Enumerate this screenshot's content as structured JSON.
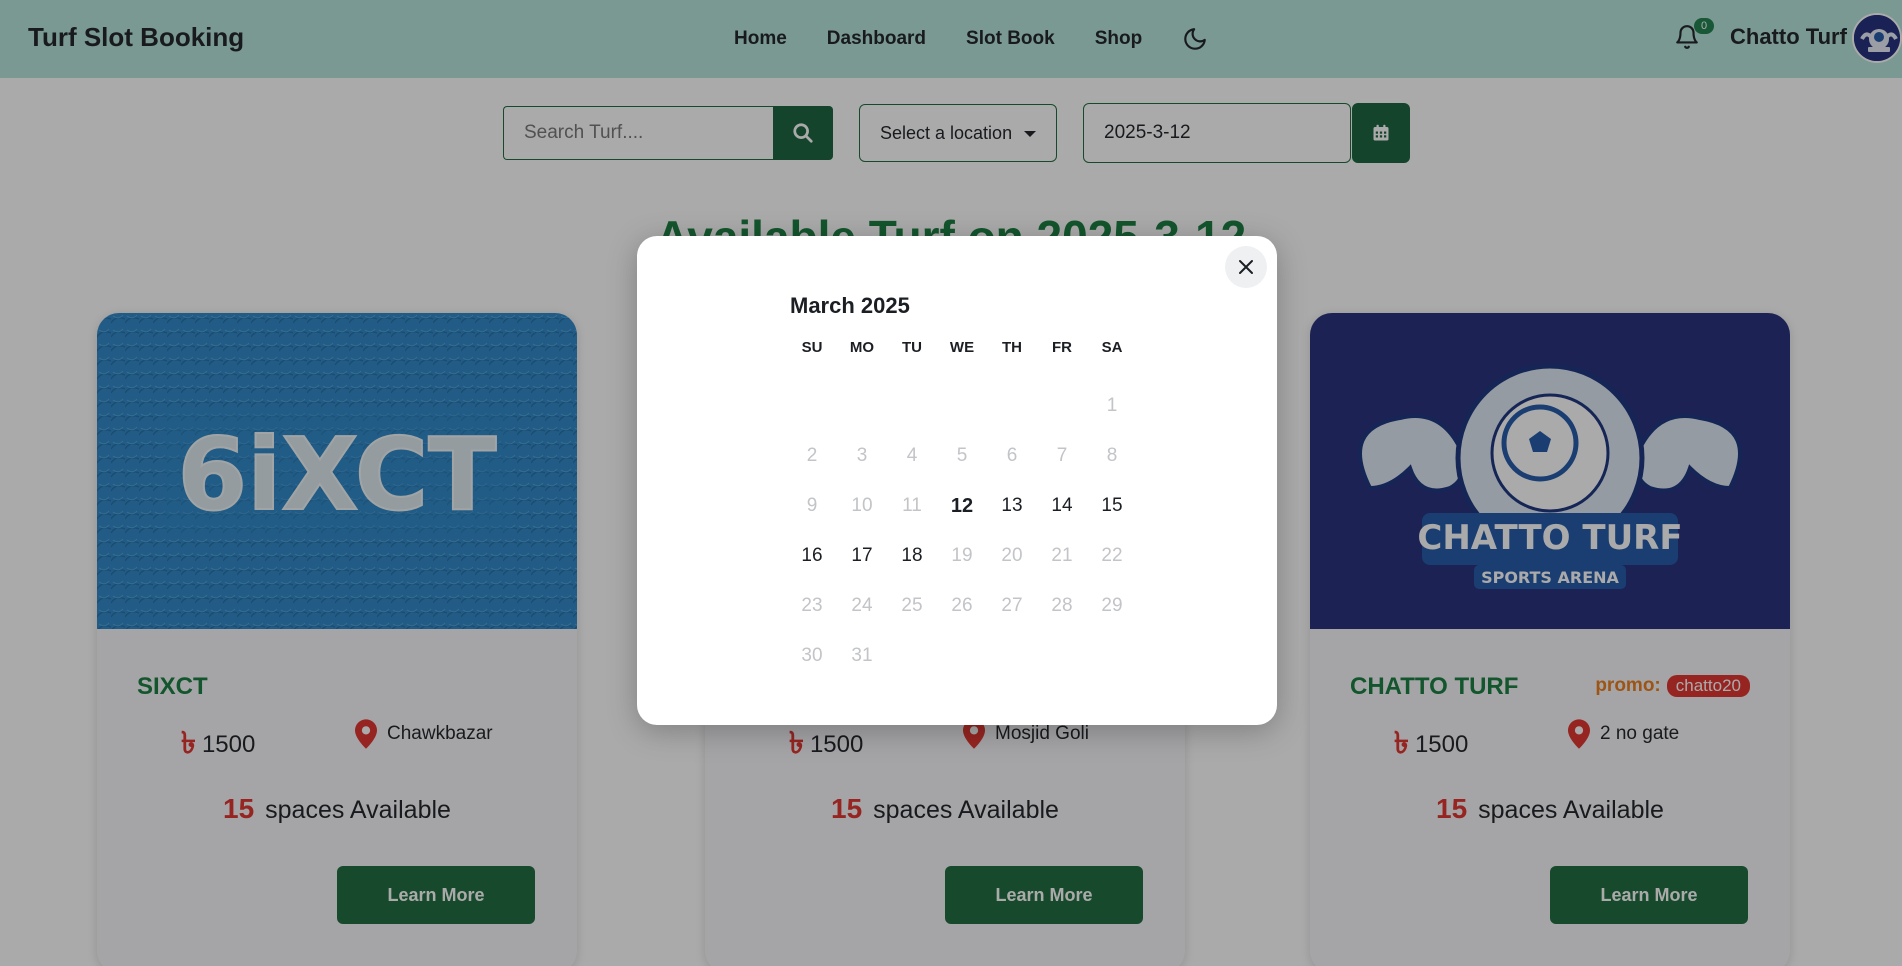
{
  "navbar": {
    "brand": "Turf Slot Booking",
    "links": [
      "Home",
      "Dashboard",
      "Slot Book",
      "Shop"
    ],
    "notification_count": "0",
    "user_name": "Chatto Turf"
  },
  "search": {
    "placeholder": "Search Turf....",
    "location_placeholder": "Select a location",
    "date_value": "2025-3-12"
  },
  "heading": "Available Turf on 2025-3-12",
  "cards": [
    {
      "image_text": "6iXCT",
      "title": "SIXCT",
      "price": "1500",
      "location": "Chawkbazar",
      "spaces_count": "15",
      "spaces_label": "spaces Available",
      "button": "Learn More"
    },
    {
      "title": "",
      "price": "1500",
      "location": "Mosjid Goli",
      "spaces_count": "15",
      "spaces_label": "spaces Available",
      "button": "Learn More"
    },
    {
      "image_text": "CHATTO TURF",
      "image_subtext": "SPORTS ARENA",
      "title": "CHATTO TURF",
      "promo_label": "promo:",
      "promo_code": "chatto20",
      "price": "1500",
      "location": "2 no gate",
      "spaces_count": "15",
      "spaces_label": "spaces Available",
      "button": "Learn More"
    }
  ],
  "calendar": {
    "month_label": "March 2025",
    "weekdays": [
      "SU",
      "MO",
      "TU",
      "WE",
      "TH",
      "FR",
      "SA"
    ],
    "selected_day": 12,
    "enabled_days": [
      12,
      13,
      14,
      15,
      16,
      17,
      18
    ],
    "weeks": [
      [
        "",
        "",
        "",
        "",
        "",
        "",
        "1"
      ],
      [
        "2",
        "3",
        "4",
        "5",
        "6",
        "7",
        "8"
      ],
      [
        "9",
        "10",
        "11",
        "12",
        "13",
        "14",
        "15"
      ],
      [
        "16",
        "17",
        "18",
        "19",
        "20",
        "21",
        "22"
      ],
      [
        "23",
        "24",
        "25",
        "26",
        "27",
        "28",
        "29"
      ],
      [
        "30",
        "31",
        "",
        "",
        "",
        "",
        ""
      ]
    ]
  },
  "icons": {
    "theme": "moon-icon",
    "notifications": "bell-icon",
    "search": "search-icon",
    "calendar": "calendar-icon",
    "close": "close-icon",
    "location": "map-pin-icon",
    "currency": "taka-icon"
  },
  "colors": {
    "navbar_bg": "#b2e4d9",
    "primary_green": "#15603a",
    "heading_green": "#137a3c",
    "accent_red": "#e0302a",
    "promo_orange": "#e97a1a"
  }
}
